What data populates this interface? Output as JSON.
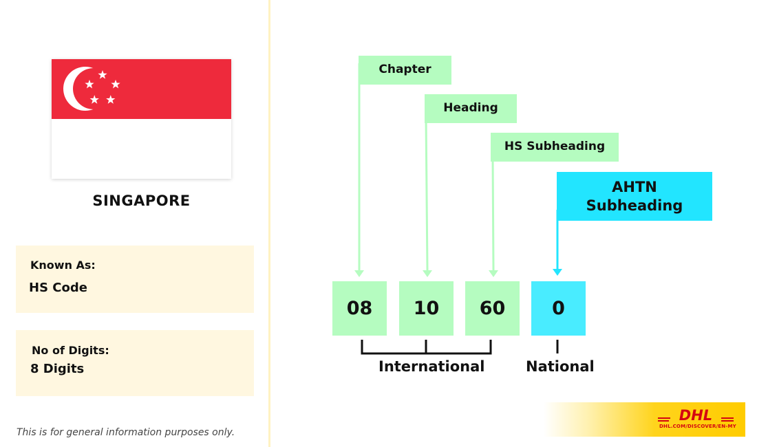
{
  "country": {
    "name": "SINGAPORE",
    "flag_icon": "singapore-flag-icon"
  },
  "info": {
    "known_as_label": "Known As:",
    "known_as_value": "HS Code",
    "digits_label": "No of Digits:",
    "digits_value": "8 Digits"
  },
  "disclaimer": "This is for general information purposes only.",
  "diagram": {
    "labels": [
      {
        "text": "Chapter",
        "color": "#b5fcc0"
      },
      {
        "text": "Heading",
        "color": "#b5fcc0"
      },
      {
        "text": "HS Subheading",
        "color": "#b5fcc0"
      },
      {
        "text": "AHTN\nSubheading",
        "color": "#22e5ff"
      }
    ],
    "digits": [
      {
        "value": "08",
        "color": "#b5fcc0"
      },
      {
        "value": "10",
        "color": "#b5fcc0"
      },
      {
        "value": "60",
        "color": "#b5fcc0"
      },
      {
        "value": "0",
        "color": "#49ecff"
      }
    ],
    "groups": {
      "international": "International",
      "national": "National"
    }
  },
  "brand": {
    "logo": "DHL",
    "url": "DHL.COM/DISCOVER/EN-MY",
    "colors": {
      "yellow": "#ffcc00",
      "red": "#d40511"
    }
  }
}
